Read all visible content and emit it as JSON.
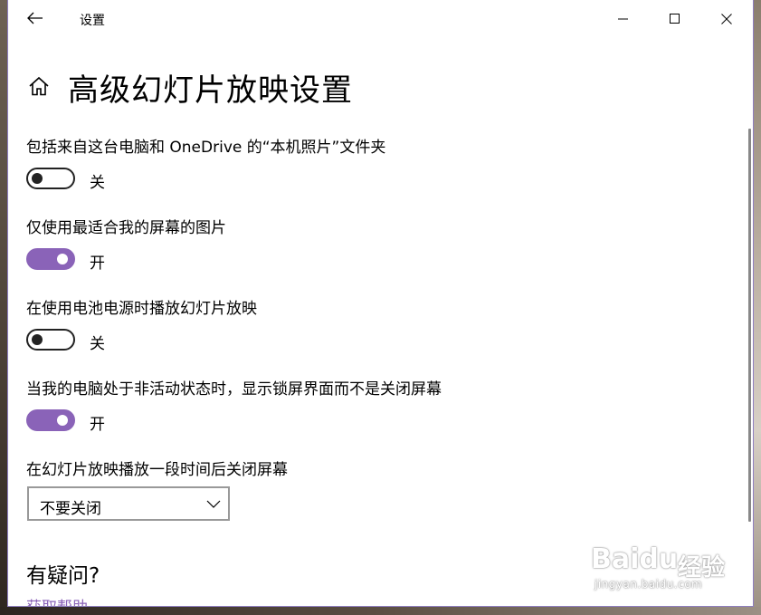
{
  "window": {
    "title": "设置"
  },
  "page": {
    "title": "高级幻灯片放映设置"
  },
  "settings": [
    {
      "label": "包括来自这台电脑和 OneDrive 的“本机照片”文件夹",
      "state": "关",
      "on": false
    },
    {
      "label": "仅使用最适合我的屏幕的图片",
      "state": "开",
      "on": true
    },
    {
      "label": "在使用电池电源时播放幻灯片放映",
      "state": "关",
      "on": false
    },
    {
      "label": "当我的电脑处于非活动状态时，显示锁屏界面而不是关闭屏幕",
      "state": "开",
      "on": true
    }
  ],
  "screen_off": {
    "label": "在幻灯片放映播放一段时间后关闭屏幕",
    "selected": "不要关闭"
  },
  "help": {
    "heading": "有疑问?",
    "link": "获取帮助"
  },
  "watermark": {
    "brand": "Baidu",
    "product": "经验",
    "url": "jingyan.baidu.com"
  },
  "colors": {
    "accent": "#8a63b8",
    "window_border": "#8f7fc0"
  },
  "icons": {
    "back": "back-arrow-icon",
    "home": "home-icon",
    "minimize": "minimize-icon",
    "maximize": "maximize-icon",
    "close": "close-icon",
    "dropdown": "chevron-down-icon"
  }
}
